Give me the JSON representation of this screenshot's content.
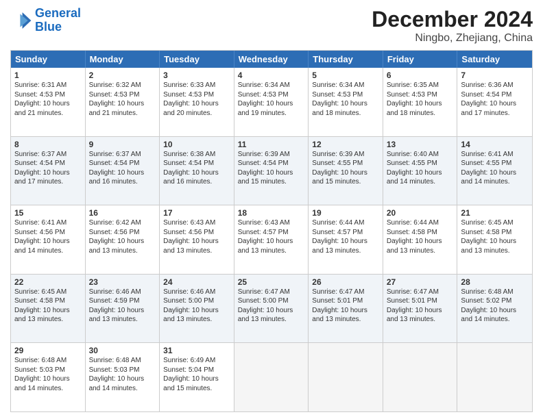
{
  "logo": {
    "line1": "General",
    "line2": "Blue"
  },
  "title": "December 2024",
  "subtitle": "Ningbo, Zhejiang, China",
  "header_days": [
    "Sunday",
    "Monday",
    "Tuesday",
    "Wednesday",
    "Thursday",
    "Friday",
    "Saturday"
  ],
  "rows": [
    [
      {
        "day": "1",
        "info": "Sunrise: 6:31 AM\nSunset: 4:53 PM\nDaylight: 10 hours\nand 21 minutes."
      },
      {
        "day": "2",
        "info": "Sunrise: 6:32 AM\nSunset: 4:53 PM\nDaylight: 10 hours\nand 21 minutes."
      },
      {
        "day": "3",
        "info": "Sunrise: 6:33 AM\nSunset: 4:53 PM\nDaylight: 10 hours\nand 20 minutes."
      },
      {
        "day": "4",
        "info": "Sunrise: 6:34 AM\nSunset: 4:53 PM\nDaylight: 10 hours\nand 19 minutes."
      },
      {
        "day": "5",
        "info": "Sunrise: 6:34 AM\nSunset: 4:53 PM\nDaylight: 10 hours\nand 18 minutes."
      },
      {
        "day": "6",
        "info": "Sunrise: 6:35 AM\nSunset: 4:53 PM\nDaylight: 10 hours\nand 18 minutes."
      },
      {
        "day": "7",
        "info": "Sunrise: 6:36 AM\nSunset: 4:54 PM\nDaylight: 10 hours\nand 17 minutes."
      }
    ],
    [
      {
        "day": "8",
        "info": "Sunrise: 6:37 AM\nSunset: 4:54 PM\nDaylight: 10 hours\nand 17 minutes."
      },
      {
        "day": "9",
        "info": "Sunrise: 6:37 AM\nSunset: 4:54 PM\nDaylight: 10 hours\nand 16 minutes."
      },
      {
        "day": "10",
        "info": "Sunrise: 6:38 AM\nSunset: 4:54 PM\nDaylight: 10 hours\nand 16 minutes."
      },
      {
        "day": "11",
        "info": "Sunrise: 6:39 AM\nSunset: 4:54 PM\nDaylight: 10 hours\nand 15 minutes."
      },
      {
        "day": "12",
        "info": "Sunrise: 6:39 AM\nSunset: 4:55 PM\nDaylight: 10 hours\nand 15 minutes."
      },
      {
        "day": "13",
        "info": "Sunrise: 6:40 AM\nSunset: 4:55 PM\nDaylight: 10 hours\nand 14 minutes."
      },
      {
        "day": "14",
        "info": "Sunrise: 6:41 AM\nSunset: 4:55 PM\nDaylight: 10 hours\nand 14 minutes."
      }
    ],
    [
      {
        "day": "15",
        "info": "Sunrise: 6:41 AM\nSunset: 4:56 PM\nDaylight: 10 hours\nand 14 minutes."
      },
      {
        "day": "16",
        "info": "Sunrise: 6:42 AM\nSunset: 4:56 PM\nDaylight: 10 hours\nand 13 minutes."
      },
      {
        "day": "17",
        "info": "Sunrise: 6:43 AM\nSunset: 4:56 PM\nDaylight: 10 hours\nand 13 minutes."
      },
      {
        "day": "18",
        "info": "Sunrise: 6:43 AM\nSunset: 4:57 PM\nDaylight: 10 hours\nand 13 minutes."
      },
      {
        "day": "19",
        "info": "Sunrise: 6:44 AM\nSunset: 4:57 PM\nDaylight: 10 hours\nand 13 minutes."
      },
      {
        "day": "20",
        "info": "Sunrise: 6:44 AM\nSunset: 4:58 PM\nDaylight: 10 hours\nand 13 minutes."
      },
      {
        "day": "21",
        "info": "Sunrise: 6:45 AM\nSunset: 4:58 PM\nDaylight: 10 hours\nand 13 minutes."
      }
    ],
    [
      {
        "day": "22",
        "info": "Sunrise: 6:45 AM\nSunset: 4:58 PM\nDaylight: 10 hours\nand 13 minutes."
      },
      {
        "day": "23",
        "info": "Sunrise: 6:46 AM\nSunset: 4:59 PM\nDaylight: 10 hours\nand 13 minutes."
      },
      {
        "day": "24",
        "info": "Sunrise: 6:46 AM\nSunset: 5:00 PM\nDaylight: 10 hours\nand 13 minutes."
      },
      {
        "day": "25",
        "info": "Sunrise: 6:47 AM\nSunset: 5:00 PM\nDaylight: 10 hours\nand 13 minutes."
      },
      {
        "day": "26",
        "info": "Sunrise: 6:47 AM\nSunset: 5:01 PM\nDaylight: 10 hours\nand 13 minutes."
      },
      {
        "day": "27",
        "info": "Sunrise: 6:47 AM\nSunset: 5:01 PM\nDaylight: 10 hours\nand 13 minutes."
      },
      {
        "day": "28",
        "info": "Sunrise: 6:48 AM\nSunset: 5:02 PM\nDaylight: 10 hours\nand 14 minutes."
      }
    ],
    [
      {
        "day": "29",
        "info": "Sunrise: 6:48 AM\nSunset: 5:03 PM\nDaylight: 10 hours\nand 14 minutes."
      },
      {
        "day": "30",
        "info": "Sunrise: 6:48 AM\nSunset: 5:03 PM\nDaylight: 10 hours\nand 14 minutes."
      },
      {
        "day": "31",
        "info": "Sunrise: 6:49 AM\nSunset: 5:04 PM\nDaylight: 10 hours\nand 15 minutes."
      },
      {
        "day": "",
        "info": ""
      },
      {
        "day": "",
        "info": ""
      },
      {
        "day": "",
        "info": ""
      },
      {
        "day": "",
        "info": ""
      }
    ]
  ]
}
